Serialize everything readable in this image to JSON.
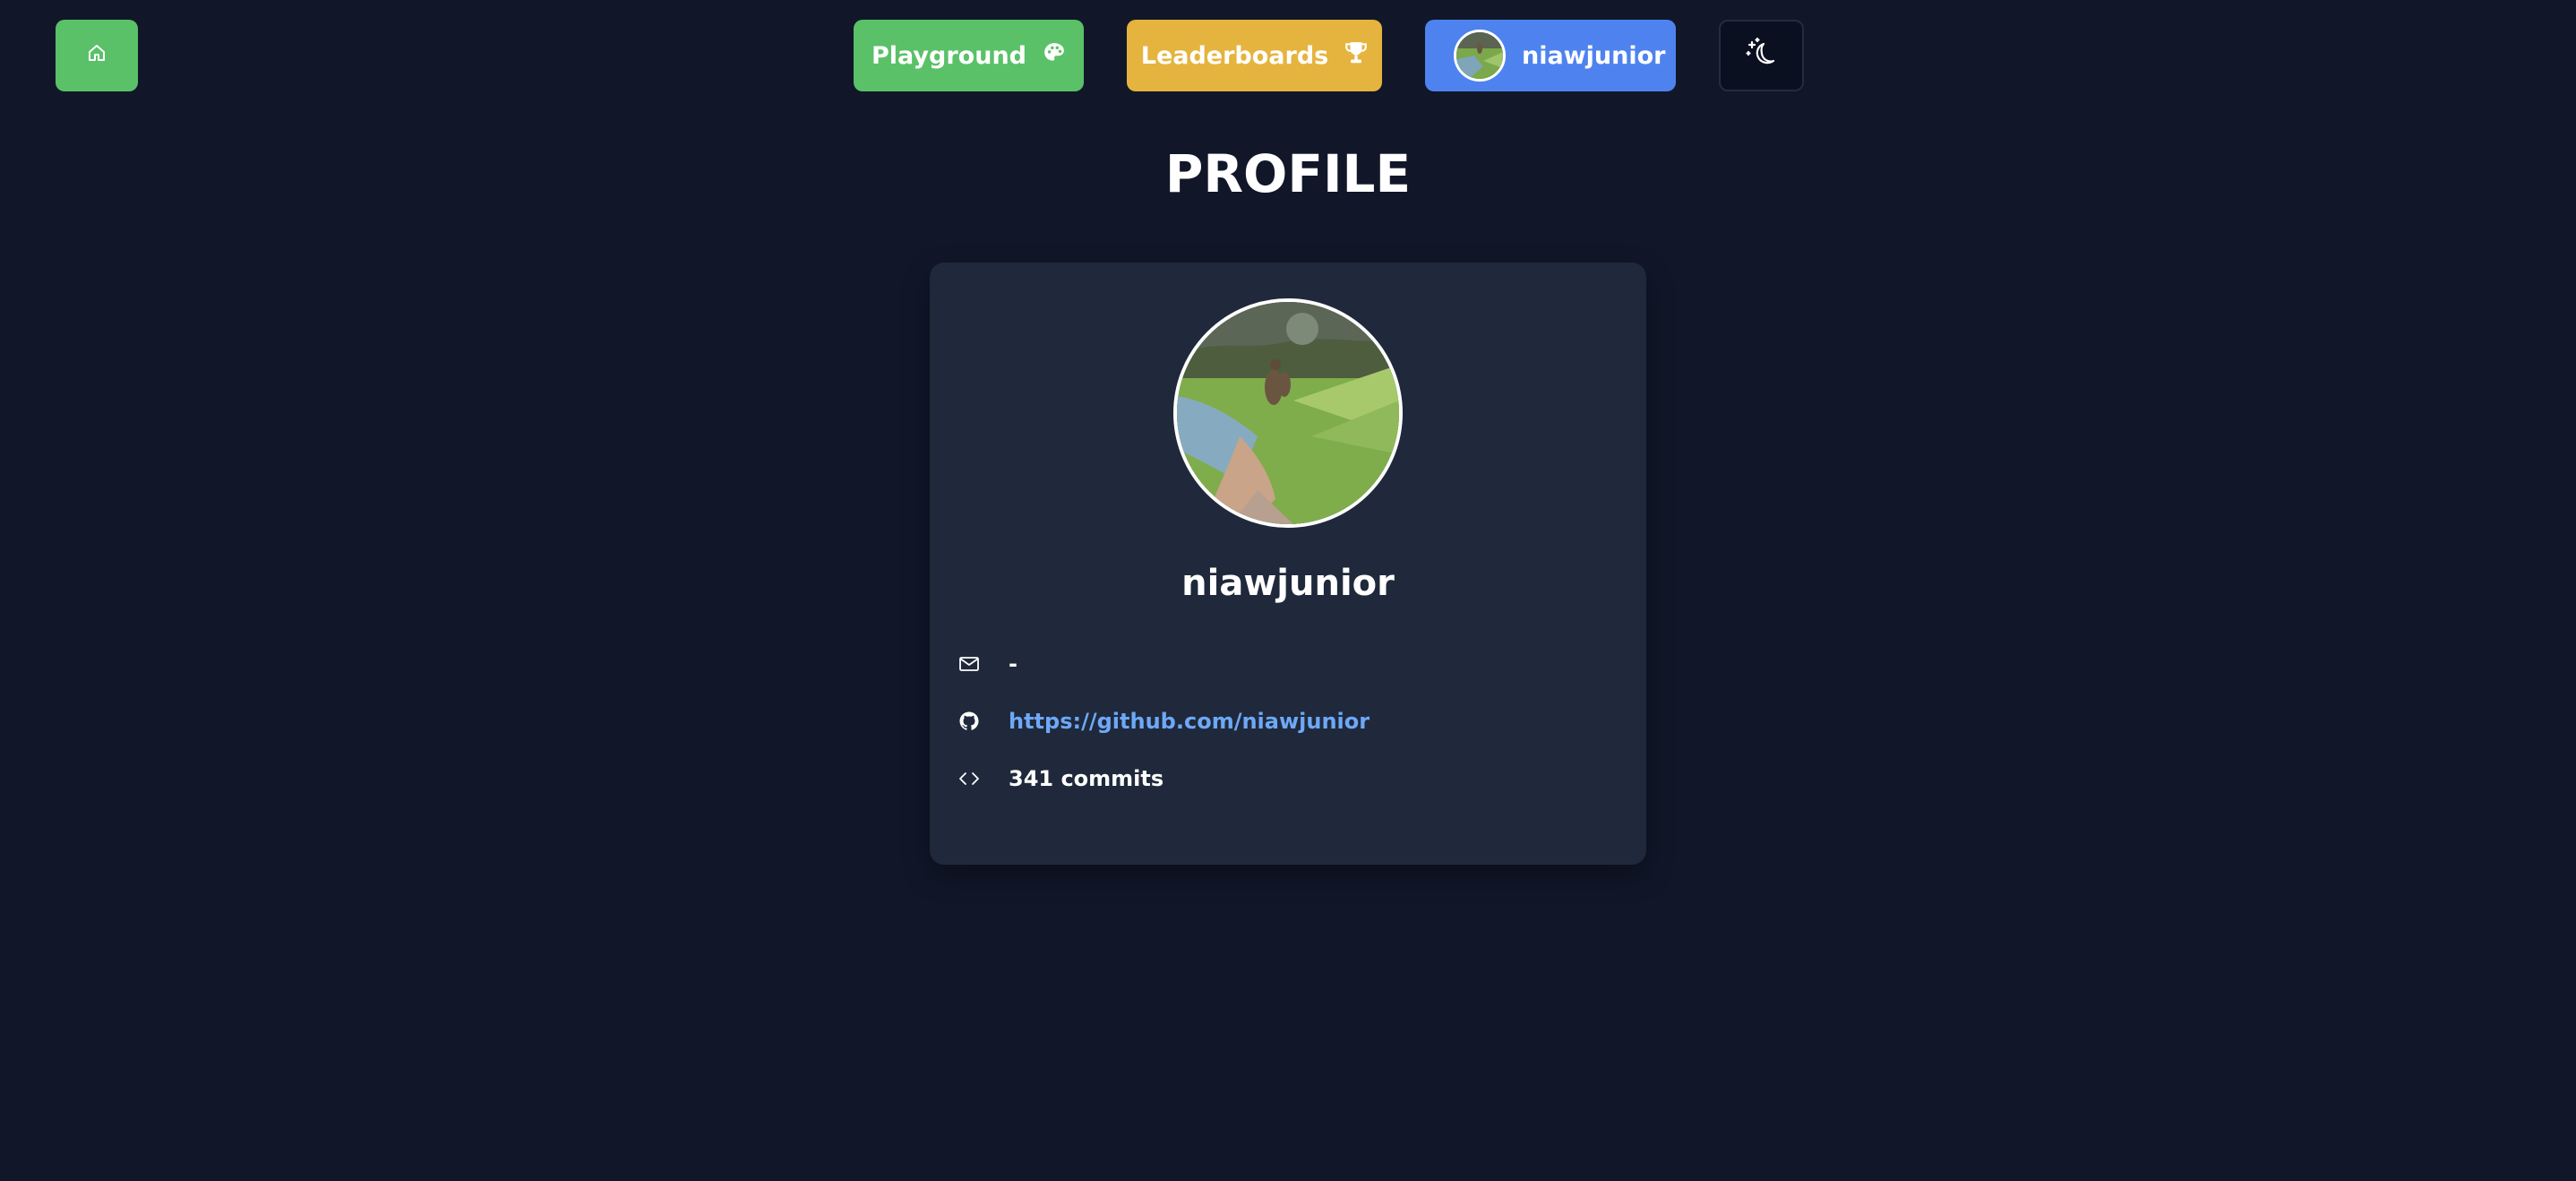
{
  "nav": {
    "home_icon": "home-icon",
    "playground_label": "Playground",
    "playground_icon": "palette-icon",
    "leaderboards_label": "Leaderboards",
    "leaderboards_icon": "trophy-icon",
    "profile_label": "niawjunior",
    "theme_icon": "moon-stars-icon"
  },
  "page": {
    "title": "PROFILE"
  },
  "profile": {
    "username": "niawjunior",
    "email": "-",
    "github_url": "https://github.com/niawjunior",
    "commits": "341 commits"
  },
  "colors": {
    "background": "#111729",
    "card": "#1f293b",
    "green": "#5ac168",
    "yellow": "#e5b43e",
    "blue": "#4e83ef",
    "link": "#6ea8f7"
  }
}
